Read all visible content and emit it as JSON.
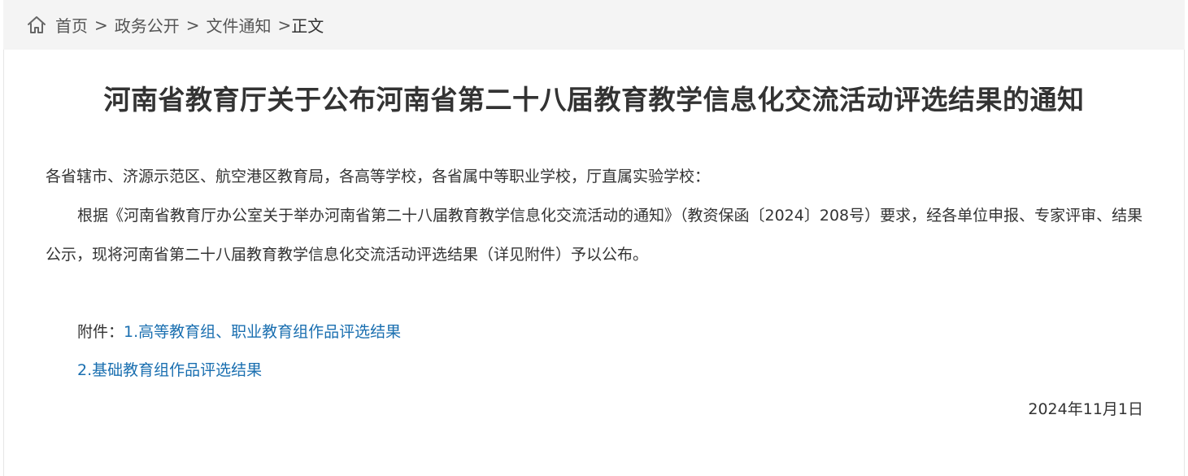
{
  "breadcrumb": {
    "home": "首页",
    "section": "政务公开",
    "category": "文件通知",
    "current": "正文",
    "separator": ">"
  },
  "article": {
    "title": "河南省教育厅关于公布河南省第二十八届教育教学信息化交流活动评选结果的通知",
    "salutation": "各省辖市、济源示范区、航空港区教育局，各高等学校，各省属中等职业学校，厅直属实验学校：",
    "paragraph": "根据《河南省教育厅办公室关于举办河南省第二十八届教育教学信息化交流活动的通知》（教资保函〔2024〕208号）要求，经各单位申报、专家评审、结果公示，现将河南省第二十八届教育教学信息化交流活动评选结果（详见附件）予以公布。",
    "attachment_label": "附件：",
    "attachments": [
      "1.高等教育组、职业教育组作品评选结果",
      "2.基础教育组作品评选结果"
    ],
    "date": "2024年11月1日"
  },
  "icons": {
    "home": "home-icon"
  },
  "colors": {
    "link": "#1a6fb0",
    "breadcrumb_bg": "#f4f4f4",
    "text": "#333333"
  }
}
